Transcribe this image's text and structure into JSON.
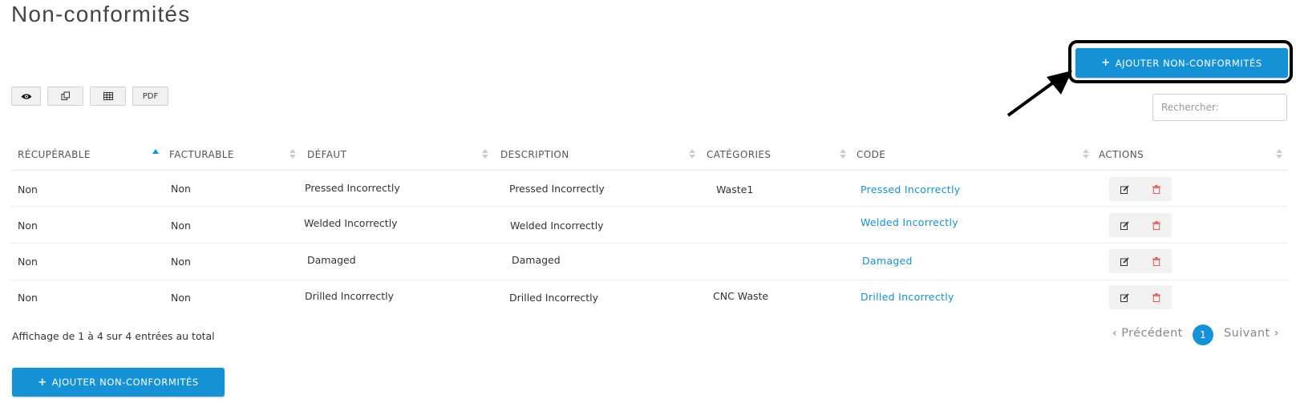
{
  "page": {
    "title": "Non-conformités"
  },
  "actions": {
    "add_label": "AJOUTER NON-CONFORMITÉS",
    "plus_symbol": "+"
  },
  "toolbar": {
    "buttons": [
      {
        "icon": "eye-icon",
        "label": ""
      },
      {
        "icon": "copy-icon",
        "label": ""
      },
      {
        "icon": "table-icon",
        "label": ""
      },
      {
        "icon": "pdf-icon",
        "label": "PDF"
      }
    ]
  },
  "search": {
    "placeholder": "Rechercher:"
  },
  "table": {
    "columns": [
      "RÉCUPÉRABLE",
      "FACTURABLE",
      "DÉFAUT",
      "DESCRIPTION",
      "CATÉGORIES",
      "CODE",
      "ACTIONS"
    ],
    "sorted_column": "RÉCUPÉRABLE",
    "rows": [
      {
        "recuperable": "Non",
        "facturable": "Non",
        "defaut": "Pressed Incorrectly",
        "description": "Pressed Incorrectly",
        "categories": "Waste1",
        "code": "Pressed Incorrectly"
      },
      {
        "recuperable": "Non",
        "facturable": "Non",
        "defaut": "Welded Incorrectly",
        "description": "Welded Incorrectly",
        "categories": "",
        "code": "Welded Incorrectly"
      },
      {
        "recuperable": "Non",
        "facturable": "Non",
        "defaut": "Damaged",
        "description": "Damaged",
        "categories": "",
        "code": "Damaged"
      },
      {
        "recuperable": "Non",
        "facturable": "Non",
        "defaut": "Drilled Incorrectly",
        "description": "Drilled Incorrectly",
        "categories": "CNC Waste",
        "code": "Drilled Incorrectly"
      }
    ],
    "row_actions": [
      "edit-icon",
      "trash-icon"
    ]
  },
  "footer": {
    "info": "Affichage de 1 à 4 sur 4 entrées au total"
  },
  "pagination": {
    "prev": "‹ Précédent",
    "current": "1",
    "next": "Suivant ›"
  },
  "colors": {
    "accent": "#1592d6",
    "link": "#1a8fcc",
    "delete": "#e05555",
    "highlight": "#000000"
  }
}
